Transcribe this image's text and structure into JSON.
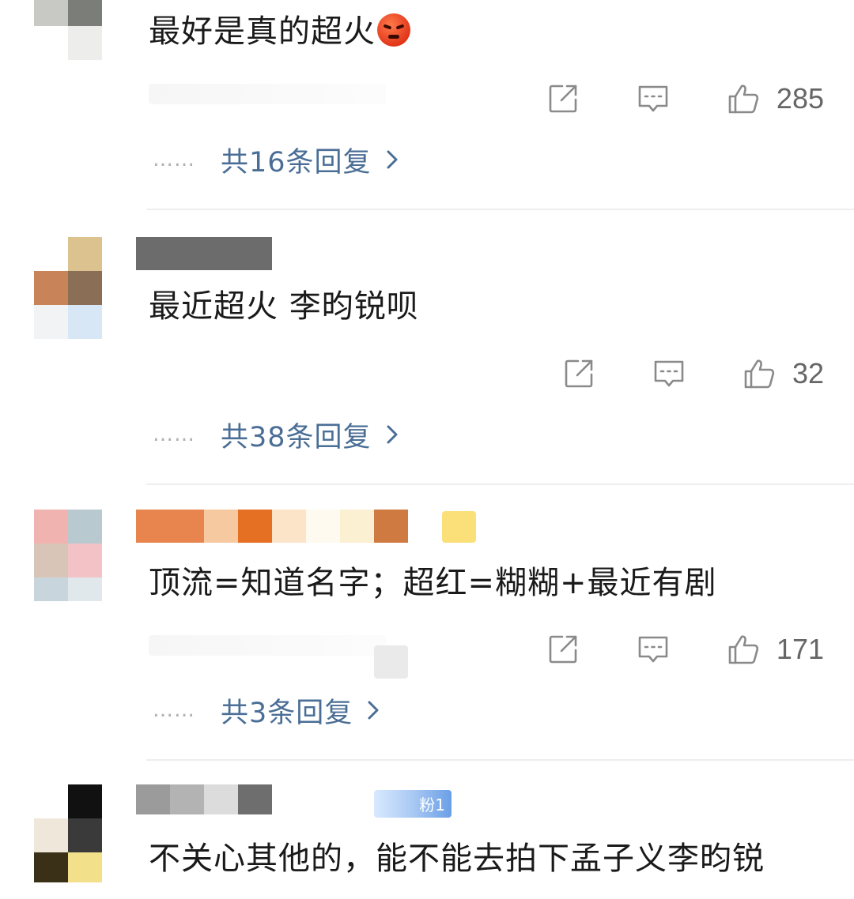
{
  "comments": [
    {
      "text": "最好是真的超火",
      "emoji": "angry-face-emoji",
      "likes": "285",
      "replies_label": "共16条回复"
    },
    {
      "text": "最近超火 李昀锐呗",
      "likes": "32",
      "replies_label": "共38条回复"
    },
    {
      "text": "顶流=知道名字；超红=糊糊+最近有剧",
      "likes": "171",
      "replies_label": "共3条回复"
    },
    {
      "text": "不关心其他的，能不能去拍下孟子义李昀锐",
      "fan_badge": "粉1"
    }
  ],
  "reply_dots": "……",
  "icons": {
    "share": "share-icon",
    "comment": "comment-icon",
    "like": "thumbs-up-icon",
    "expand": "chevron-right-icon"
  },
  "colors": {
    "reply_link": "#4a6e96",
    "icon_gray": "#8a8a8a",
    "like_count": "#666666"
  }
}
